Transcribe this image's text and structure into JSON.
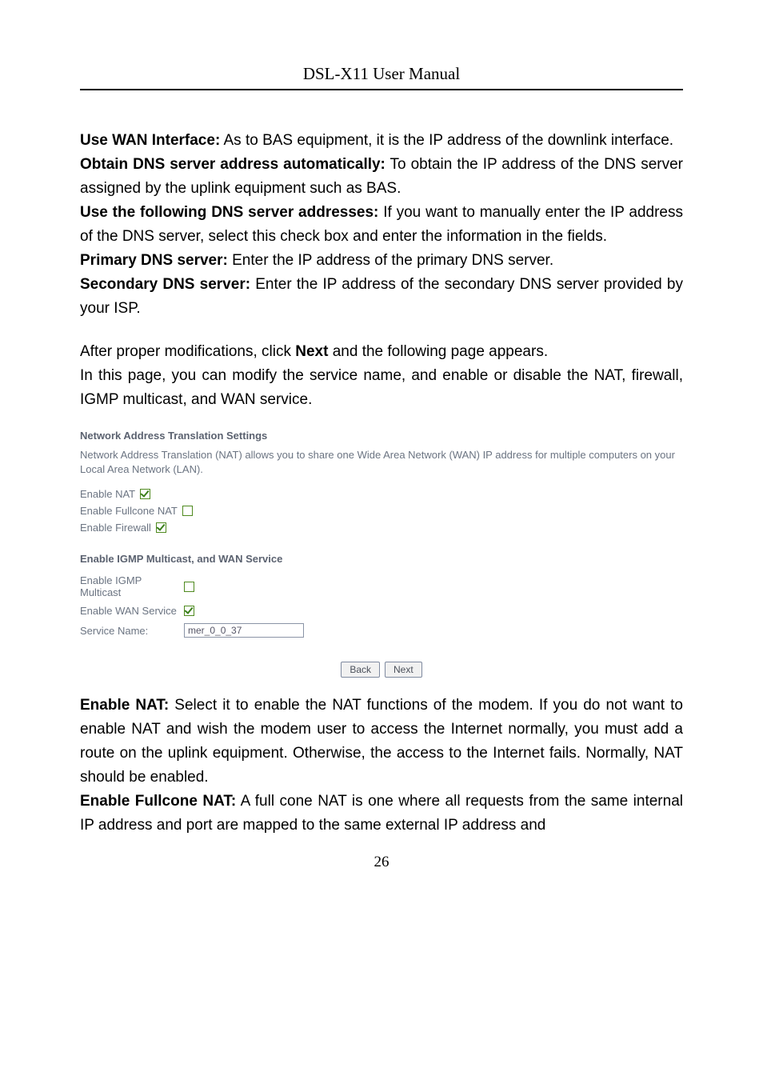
{
  "header": {
    "title": "DSL-X11 User Manual"
  },
  "sections": {
    "wan_label": "Use WAN Interface:",
    "wan_text": " As to BAS equipment, it is the IP address of the downlink interface.",
    "obtain_label": "Obtain DNS server address automatically:",
    "obtain_text": " To obtain the IP address of the DNS server assigned by the uplink equipment such as BAS.",
    "usedns_label": "Use the following DNS server addresses:",
    "usedns_text": " If you want to manually enter the IP address of the DNS server, select this check box and enter the information in the fields.",
    "primary_label": "Primary DNS server:",
    "primary_text": " Enter the IP address of the primary DNS server.",
    "secondary_label": "Secondary DNS server:",
    "secondary_text": " Enter the IP address of the secondary DNS server provided by your ISP.",
    "after_pre": "After proper modifications, click ",
    "after_bold": "Next",
    "after_post": " and the following page appears.",
    "page_intro": "In this page, you can modify the service name, and enable or disable the NAT, firewall, IGMP multicast, and WAN service."
  },
  "ui": {
    "title": "Network Address Translation Settings",
    "desc": "Network Address Translation (NAT) allows you to share one Wide Area Network (WAN) IP address for multiple computers on your Local Area Network (LAN).",
    "enable_nat": "Enable NAT",
    "enable_fullcone": "Enable Fullcone NAT",
    "enable_firewall": "Enable Firewall",
    "sub_title": "Enable IGMP Multicast, and WAN Service",
    "igmp": "Enable IGMP Multicast",
    "wan_service": "Enable WAN Service",
    "service_name_label": "Service Name:",
    "service_name_value": "mer_0_0_37",
    "btn_back": "Back",
    "btn_next": "Next",
    "checks": {
      "enable_nat": true,
      "enable_fullcone": false,
      "enable_firewall": true,
      "igmp": false,
      "wan_service": true
    }
  },
  "below": {
    "nat_label": "Enable NAT:",
    "nat_text": " Select it to enable the NAT functions of the modem. If you do not want to enable NAT and wish the modem user to access the Internet normally, you must add a route on the uplink equipment. Otherwise, the access to the Internet fails. Normally, NAT should be enabled.",
    "fullcone_label": "Enable Fullcone NAT:",
    "fullcone_text": " A full cone NAT is one where all requests from the same internal IP address and port are mapped to the same external IP address and"
  },
  "page_number": "26"
}
